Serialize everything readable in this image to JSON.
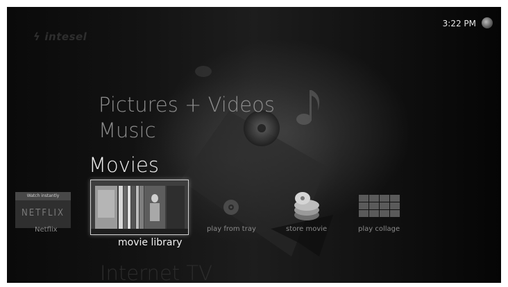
{
  "brand": {
    "name": "intesel"
  },
  "status": {
    "time": "3:22 PM"
  },
  "menu": {
    "pictures_videos": "Pictures + Videos",
    "music": "Music",
    "movies": "Movies",
    "internet_tv": "Internet TV"
  },
  "tiles": {
    "netflix": {
      "banner": "Watch instantly",
      "logo": "NETFLIX",
      "label": "Netflix"
    },
    "movie_library": {
      "label": "movie library"
    },
    "play_from_tray": {
      "label": "play from tray"
    },
    "store_movie": {
      "label": "store movie"
    },
    "play_collage": {
      "label": "play collage"
    }
  },
  "colors": {
    "background": "#111111",
    "focus_border": "#cfcfcf",
    "selected_text": "#f0f0f0",
    "inactive_text": "#8a8a8a"
  },
  "icons": [
    "status-orb-icon",
    "brand-logo-icon",
    "disc-icon",
    "disc-stack-icon",
    "collage-grid-icon",
    "music-note-icon"
  ]
}
